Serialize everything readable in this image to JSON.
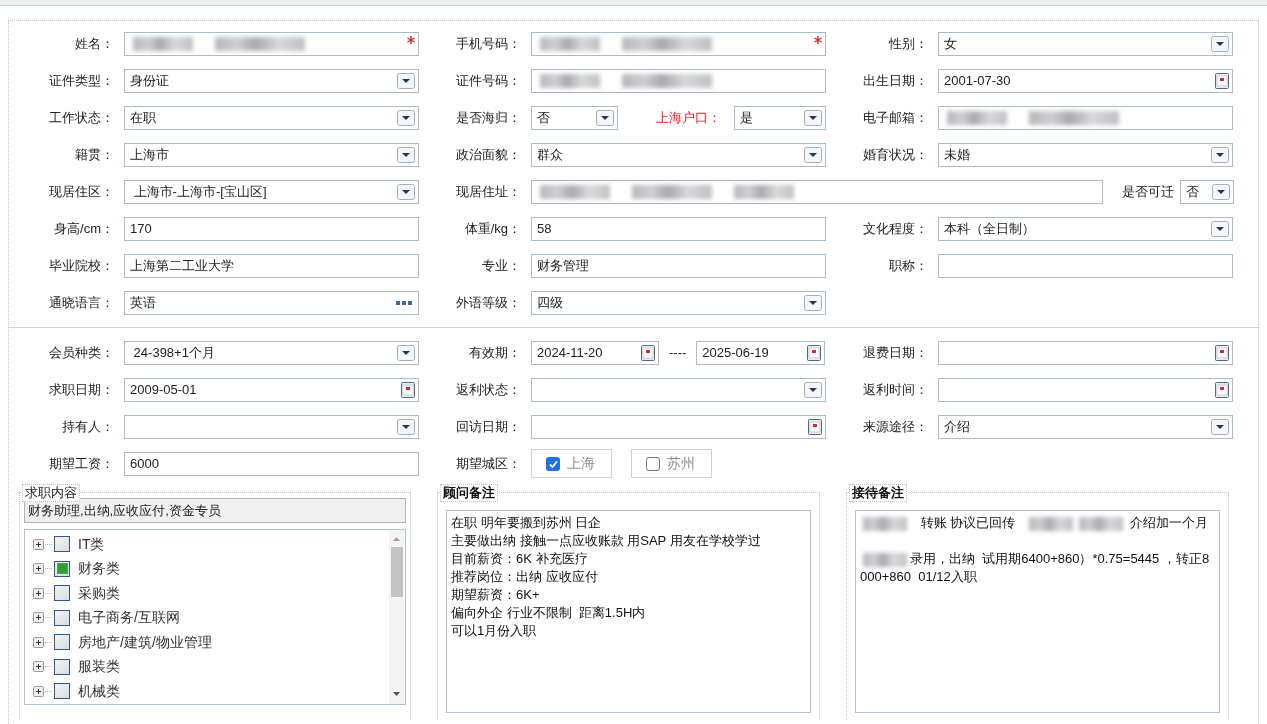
{
  "personal_rows": [
    [
      {
        "label": "姓名：",
        "control": {
          "kind": "text",
          "redacted": true,
          "required": true
        }
      },
      {
        "label": "手机号码：",
        "control": {
          "kind": "text",
          "redacted": true,
          "required": true
        }
      },
      {
        "label": "性别：",
        "control": {
          "kind": "select",
          "value": "女"
        }
      }
    ],
    [
      {
        "label": "证件类型：",
        "control": {
          "kind": "select",
          "value": "身份证"
        }
      },
      {
        "label": "证件号码：",
        "control": {
          "kind": "text",
          "redacted": true
        }
      },
      {
        "label": "出生日期：",
        "control": {
          "kind": "date",
          "value": "2001-07-30"
        }
      }
    ],
    [
      {
        "label": "工作状态：",
        "control": {
          "kind": "select",
          "value": "在职"
        }
      },
      {
        "kind": "compact",
        "label": "是否海归：",
        "control": {
          "kind": "select",
          "value": "否"
        }
      },
      {
        "kind": "inline",
        "label": "上海户口：",
        "highlight": true,
        "control": {
          "kind": "select",
          "value": "是"
        }
      },
      {
        "label": "电子邮箱：",
        "control": {
          "kind": "text",
          "redacted": true
        }
      }
    ],
    [
      {
        "label": "籍贯：",
        "control": {
          "kind": "select",
          "value": "上海市"
        }
      },
      {
        "label": "政治面貌：",
        "control": {
          "kind": "select",
          "value": "群众"
        }
      },
      {
        "label": "婚育状况：",
        "control": {
          "kind": "select",
          "value": "未婚"
        }
      }
    ],
    [
      {
        "label": "现居住区：",
        "control": {
          "kind": "select",
          "value": " 上海市-上海市-[宝山区]"
        }
      },
      {
        "kind": "wide",
        "label": "现居住址：",
        "control": {
          "kind": "text",
          "redacted": true
        }
      },
      {
        "kind": "tail",
        "label": "是否可迁",
        "control": {
          "kind": "select",
          "value": "否"
        }
      }
    ],
    [
      {
        "label": "身高/cm：",
        "control": {
          "kind": "text",
          "value": "170"
        }
      },
      {
        "label": "体重/kg：",
        "control": {
          "kind": "text",
          "value": "58"
        }
      },
      {
        "label": "文化程度：",
        "control": {
          "kind": "select",
          "value": "本科（全日制）"
        }
      }
    ],
    [
      {
        "label": "毕业院校：",
        "control": {
          "kind": "text",
          "value": "上海第二工业大学"
        }
      },
      {
        "label": "专业：",
        "control": {
          "kind": "text",
          "value": "财务管理"
        }
      },
      {
        "label": "职称：",
        "control": {
          "kind": "text"
        }
      }
    ],
    [
      {
        "label": "通晓语言：",
        "control": {
          "kind": "lookup",
          "value": "英语"
        }
      },
      {
        "label": "外语等级：",
        "control": {
          "kind": "select",
          "value": "四级"
        }
      }
    ]
  ],
  "membership_rows": [
    [
      {
        "label": "会员种类：",
        "control": {
          "kind": "select",
          "value": " 24-398+1个月"
        }
      },
      {
        "label": "有效期：",
        "control": {
          "kind": "date_range",
          "from": "2024-11-20",
          "separator": "----",
          "to": "2025-06-19"
        }
      },
      {
        "label": "退费日期：",
        "control": {
          "kind": "date"
        }
      }
    ],
    [
      {
        "label": "求职日期：",
        "control": {
          "kind": "date",
          "value": "2009-05-01"
        }
      },
      {
        "label": "返利状态：",
        "control": {
          "kind": "select"
        }
      },
      {
        "label": "返利时间：",
        "control": {
          "kind": "date"
        }
      }
    ],
    [
      {
        "label": "持有人：",
        "control": {
          "kind": "select"
        }
      },
      {
        "label": "回访日期：",
        "control": {
          "kind": "date"
        }
      },
      {
        "label": "来源途径：",
        "control": {
          "kind": "select",
          "value": "介绍"
        }
      }
    ],
    [
      {
        "label": "期望工资：",
        "control": {
          "kind": "text",
          "value": "6000"
        }
      },
      {
        "label": "期望城区：",
        "control": {
          "kind": "checkbox_group",
          "options": [
            {
              "label": "上海",
              "checked": true
            },
            {
              "label": "苏州",
              "checked": false
            }
          ]
        }
      }
    ]
  ],
  "job_content": {
    "title": "求职内容",
    "title_bold": false,
    "summary": "财务助理,出纳,应收应付,资金专员",
    "tree": [
      {
        "label": "IT类",
        "checked": false
      },
      {
        "label": "财务类",
        "checked": true
      },
      {
        "label": "采购类",
        "checked": false
      },
      {
        "label": "电子商务/互联网",
        "checked": false
      },
      {
        "label": "房地产/建筑/物业管理",
        "checked": false
      },
      {
        "label": "服装类",
        "checked": false
      },
      {
        "label": "机械类",
        "checked": false
      }
    ]
  },
  "consultant_notes": {
    "title": "顾问备注",
    "title_bold": true,
    "paragraphs": [
      [
        [
          {
            "text": "在职 明年要搬到苏州 日企"
          }
        ],
        [
          {
            "text": "主要做出纳 接触一点应收账款 用SAP 用友在学校学过"
          }
        ],
        [
          {
            "text": "目前薪资：6K 补充医疗"
          }
        ],
        [
          {
            "text": "推荐岗位：出纳 应收应付"
          }
        ],
        [
          {
            "text": "期望薪资：6K+"
          }
        ],
        [
          {
            "text": "偏向外企 行业不限制  距离1.5H内"
          }
        ],
        [
          {
            "text": "可以1月份入职"
          }
        ]
      ]
    ]
  },
  "reception_notes": {
    "title": "接待备注",
    "title_bold": true,
    "paragraphs": [
      [
        [
          {
            "redacted": true
          },
          {
            "text": "   转账 协议已回传   "
          },
          {
            "redacted": true
          },
          {
            "redacted": true
          },
          {
            "text": " 介绍加一个月"
          }
        ]
      ],
      [
        [
          {
            "redacted": true
          },
          {
            "text": "录用，出纳  试用期6400+860）*0.75=5445 ，转正8000+860  01/12入职"
          }
        ]
      ]
    ]
  }
}
